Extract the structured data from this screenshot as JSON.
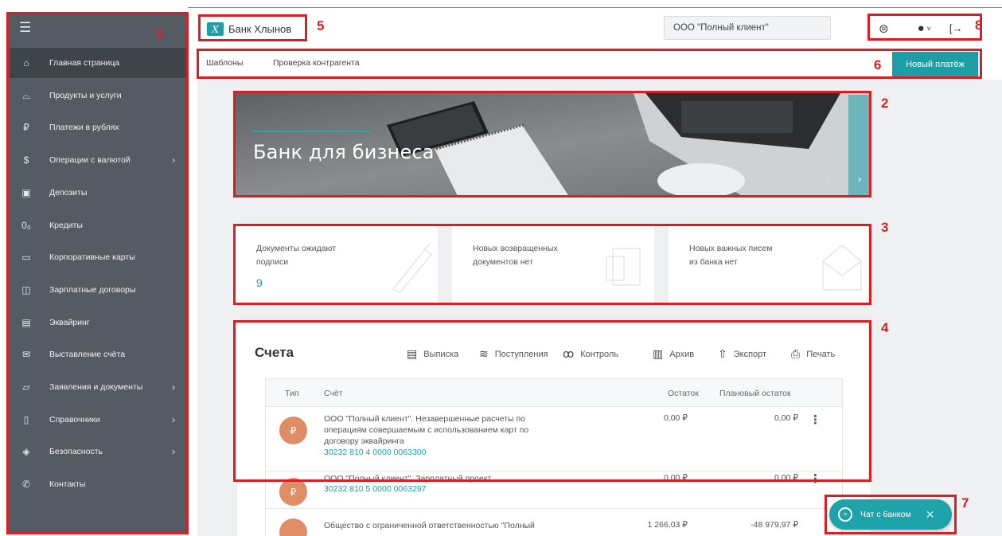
{
  "sidebar": {
    "menu_icon": "hamburger-icon",
    "items": [
      {
        "label": "Главная страница",
        "icon": "home-icon",
        "glyph": "⌂",
        "arrow": ""
      },
      {
        "label": "Продукты и услуги",
        "icon": "bag-icon",
        "glyph": "⌓",
        "arrow": ""
      },
      {
        "label": "Платежи в рублях",
        "icon": "ruble-icon",
        "glyph": "₽",
        "arrow": ""
      },
      {
        "label": "Операции с валютой",
        "icon": "dollar-icon",
        "glyph": "$",
        "arrow": "›"
      },
      {
        "label": "Депозиты",
        "icon": "deposit-icon",
        "glyph": "▣",
        "arrow": ""
      },
      {
        "label": "Кредиты",
        "icon": "credit-icon",
        "glyph": "0₀",
        "arrow": ""
      },
      {
        "label": "Корпоративные карты",
        "icon": "card-icon",
        "glyph": "▭",
        "arrow": ""
      },
      {
        "label": "Зарплатные договоры",
        "icon": "wallet-icon",
        "glyph": "◫",
        "arrow": ""
      },
      {
        "label": "Эквайринг",
        "icon": "terminal-icon",
        "glyph": "▤",
        "arrow": ""
      },
      {
        "label": "Выставление счёта",
        "icon": "invoice-icon",
        "glyph": "✉",
        "arrow": ""
      },
      {
        "label": "Заявления и документы",
        "icon": "folder-icon",
        "glyph": "▱",
        "arrow": "›"
      },
      {
        "label": "Справочники",
        "icon": "book-icon",
        "glyph": "▯",
        "arrow": "›"
      },
      {
        "label": "Безопасность",
        "icon": "shield-icon",
        "glyph": "◈",
        "arrow": "›"
      },
      {
        "label": "Контакты",
        "icon": "phone-icon",
        "glyph": "✆",
        "arrow": ""
      }
    ]
  },
  "header": {
    "bank_name": "Банк Хлынов",
    "logo_letter": "X",
    "client": "ООО \"Полный клиент\"",
    "icons": [
      "chat-icon",
      "user-icon",
      "logout-icon"
    ]
  },
  "nav": {
    "templates": "Шаблоны",
    "check": "Проверка контрагента",
    "new_payment": "Новый платёж"
  },
  "banner": {
    "title": "Банк для бизнеса",
    "prev": "‹",
    "next": "›"
  },
  "cards": [
    {
      "text_line1": "Документы ожидают",
      "text_line2": "подписи",
      "count": "9"
    },
    {
      "text_line1": "Новых возвращенных",
      "text_line2": "документов нет",
      "count": ""
    },
    {
      "text_line1": "Новых важных писем",
      "text_line2": "из банка нет",
      "count": ""
    }
  ],
  "accounts": {
    "title": "Счета",
    "tools": [
      {
        "label": "Выписка",
        "icon": "document-icon",
        "glyph": "▤"
      },
      {
        "label": "Поступления",
        "icon": "incoming-icon",
        "glyph": "≋"
      },
      {
        "label": "Контроль",
        "icon": "binoculars-icon",
        "glyph": "ꝏ"
      },
      {
        "label": "Архив",
        "icon": "archive-icon",
        "glyph": "▥"
      },
      {
        "label": "Экспорт",
        "icon": "export-icon",
        "glyph": "⇧"
      },
      {
        "label": "Печать",
        "icon": "print-icon",
        "glyph": "⎙"
      }
    ],
    "columns": [
      "Тип",
      "Счёт",
      "Остаток",
      "Плановый остаток"
    ],
    "rows": [
      {
        "type": "₽",
        "name_lines": [
          "ООО \"Полный клиент\". Незавершенные расчеты по",
          "операциям совершаемым с использованием карт по",
          "договору эквайринга"
        ],
        "number": "30232 810 4 0000 0063300",
        "balance": "0,00 ₽",
        "planned": "0,00 ₽"
      },
      {
        "type": "₽",
        "name_lines": [
          "ООО \"Полный клиент\". Зарплатный проект"
        ],
        "number": "30232 810 5 0000 0063297",
        "balance": "0,00 ₽",
        "planned": "0,00 ₽"
      },
      {
        "type": "",
        "name_lines": [
          "Общество с ограниченной ответственностью \"Полный"
        ],
        "number": "",
        "balance": "1 266,03 ₽",
        "planned": "-48 979,97 ₽"
      }
    ]
  },
  "chat": {
    "label": "Чат с банком",
    "close": "✕"
  },
  "annotations": [
    "1",
    "2",
    "3",
    "4",
    "5",
    "6",
    "7",
    "8"
  ],
  "colors": {
    "accent": "#1d9da6",
    "sidebar": "#555b63",
    "sidebar_active": "#3f444b",
    "annotation": "#d81f26",
    "badge": "#e08c64"
  }
}
